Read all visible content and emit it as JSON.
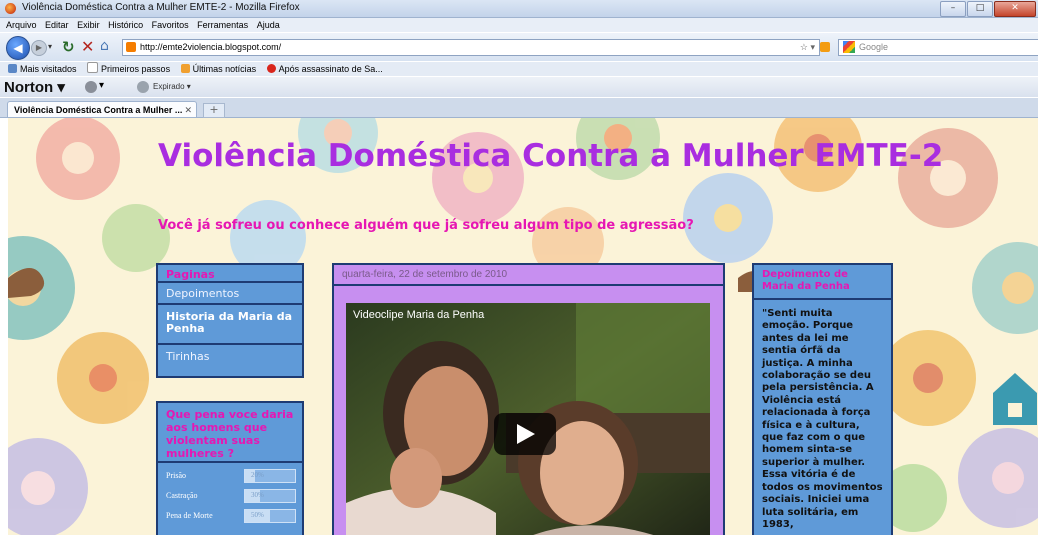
{
  "window": {
    "title": "Violência Doméstica Contra a Mulher EMTE-2 - Mozilla Firefox"
  },
  "menu": [
    "Arquivo",
    "Editar",
    "Exibir",
    "Histórico",
    "Favoritos",
    "Ferramentas",
    "Ajuda"
  ],
  "address": {
    "url": "http://emte2violencia.blogspot.com/"
  },
  "search": {
    "placeholder": "Google"
  },
  "bookmarks": [
    "Mais visitados",
    "Primeiros passos",
    "Últimas notícias",
    "Após assassinato de Sa..."
  ],
  "toolbar": {
    "norton": "Norton",
    "feed": "Expirado"
  },
  "tab": {
    "label": "Violência Doméstica Contra a Mulher ..."
  },
  "blog": {
    "title": "Violência Doméstica Contra a Mulher EMTE-2",
    "subtitle": "Você já sofreu ou conhece alguém que já sofreu algum tipo de agressão?"
  },
  "left_sidebar": {
    "heading": "Paginas",
    "items": [
      "Depoimentos",
      "Historia da Maria da Penha",
      "Tirinhas"
    ]
  },
  "poll": {
    "question": "Que pena voce daria aos homens que violentam suas mulheres ?",
    "options": [
      {
        "label": "Prisão",
        "percent": 20,
        "percent_text": "20%"
      },
      {
        "label": "Castração",
        "percent": 30,
        "percent_text": "30%"
      },
      {
        "label": "Pena de Morte",
        "percent": 50,
        "percent_text": "50%"
      }
    ]
  },
  "post": {
    "date": "quarta-feira, 22 de setembro de 2010",
    "video_title": "Videoclipe Maria da Penha"
  },
  "right_sidebar": {
    "heading": "Depoimento de Maria da Penha",
    "text": "\"Senti muita emoção. Porque antes da lei me sentia órfã da justiça. A minha colaboração se deu pela persistência. A Violência está relacionada à força física e à cultura, que faz com o que homem sinta-se superior à mulher. Essa vitória é de todos os movimentos sociais. Iniciei uma luta solitária, em 1983,"
  },
  "colors": {
    "title": "#a92de0",
    "subtitle": "#e617b3",
    "sidebar": "#5f9ad8",
    "post": "#c78ff0",
    "border": "#1e3b73"
  }
}
